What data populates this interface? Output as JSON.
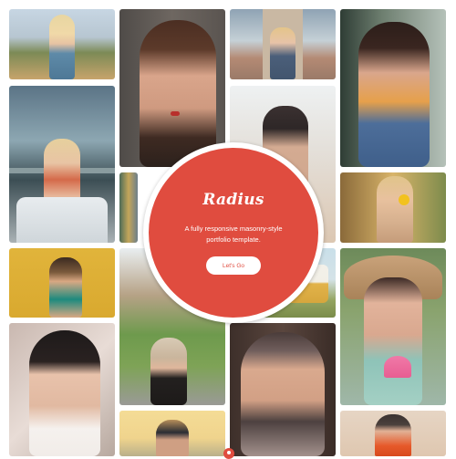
{
  "hero": {
    "title": "Radius",
    "subtitle": "A fully responsive masonry-style portfolio template.",
    "button_label": "Let's Go"
  },
  "colors": {
    "accent": "#e04c3f",
    "background": "#ffffff"
  },
  "gallery": {
    "photos": [
      "woman-blonde-hills",
      "woman-portrait-red-lips",
      "woman-desert-road",
      "woman-holding-flowers",
      "woman-chair-window",
      "woman-hands-sand",
      "woman-sunflower",
      "woman-yellow-wall",
      "woman-bus-field",
      "woman-conical-hat-lotus",
      "woman-blue-eyes",
      "woman-hands-on-head",
      "woman-headscarf",
      "woman-sunglasses-beach",
      "woman-beanie-autumn"
    ]
  }
}
